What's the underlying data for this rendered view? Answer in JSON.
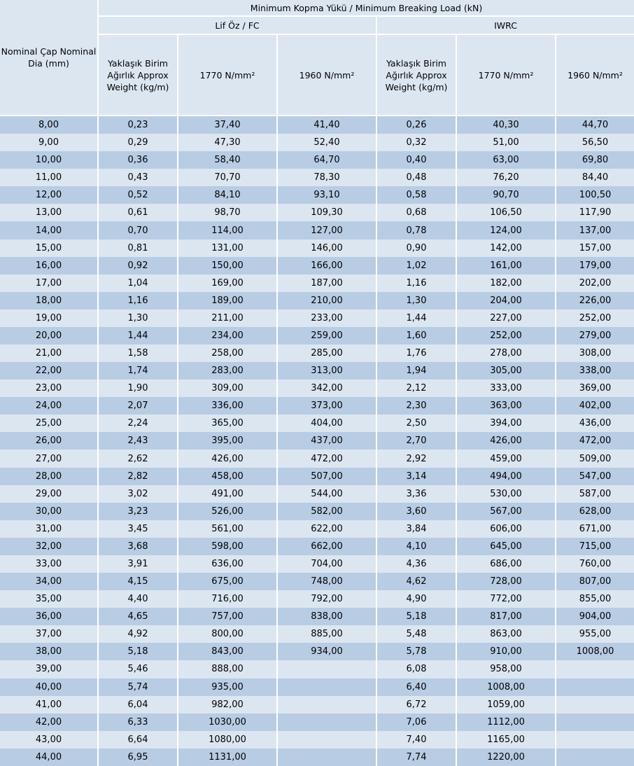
{
  "header": {
    "breaking_load": "Minimum Kopma Yükü / Minimum Breaking Load (kN)",
    "nominal_dia": "Nominal Çap Nominal Dia (mm)",
    "fc_group": "Lif Öz / FC",
    "iwrc_group": "IWRC",
    "fc_weight": "Yaklaşık Birim Ağırlık Approx Weight    (kg/m)",
    "iwrc_weight": "Yaklaşık Birim Ağırlık Approx Weight (kg/m)",
    "grade_1770_fc": "1770 N/mm²",
    "grade_1960_fc": "1960 N/mm²",
    "grade_1770_iwrc": "1770 N/mm²",
    "grade_1960_iwrc": "1960 N/mm²"
  },
  "rows": [
    [
      "8,00",
      "0,23",
      "37,40",
      "41,40",
      "0,26",
      "40,30",
      "44,70"
    ],
    [
      "9,00",
      "0,29",
      "47,30",
      "52,40",
      "0,32",
      "51,00",
      "56,50"
    ],
    [
      "10,00",
      "0,36",
      "58,40",
      "64,70",
      "0,40",
      "63,00",
      "69,80"
    ],
    [
      "11,00",
      "0,43",
      "70,70",
      "78,30",
      "0,48",
      "76,20",
      "84,40"
    ],
    [
      "12,00",
      "0,52",
      "84,10",
      "93,10",
      "0,58",
      "90,70",
      "100,50"
    ],
    [
      "13,00",
      "0,61",
      "98,70",
      "109,30",
      "0,68",
      "106,50",
      "117,90"
    ],
    [
      "14,00",
      "0,70",
      "114,00",
      "127,00",
      "0,78",
      "124,00",
      "137,00"
    ],
    [
      "15,00",
      "0,81",
      "131,00",
      "146,00",
      "0,90",
      "142,00",
      "157,00"
    ],
    [
      "16,00",
      "0,92",
      "150,00",
      "166,00",
      "1,02",
      "161,00",
      "179,00"
    ],
    [
      "17,00",
      "1,04",
      "169,00",
      "187,00",
      "1,16",
      "182,00",
      "202,00"
    ],
    [
      "18,00",
      "1,16",
      "189,00",
      "210,00",
      "1,30",
      "204,00",
      "226,00"
    ],
    [
      "19,00",
      "1,30",
      "211,00",
      "233,00",
      "1,44",
      "227,00",
      "252,00"
    ],
    [
      "20,00",
      "1,44",
      "234,00",
      "259,00",
      "1,60",
      "252,00",
      "279,00"
    ],
    [
      "21,00",
      "1,58",
      "258,00",
      "285,00",
      "1,76",
      "278,00",
      "308,00"
    ],
    [
      "22,00",
      "1,74",
      "283,00",
      "313,00",
      "1,94",
      "305,00",
      "338,00"
    ],
    [
      "23,00",
      "1,90",
      "309,00",
      "342,00",
      "2,12",
      "333,00",
      "369,00"
    ],
    [
      "24,00",
      "2,07",
      "336,00",
      "373,00",
      "2,30",
      "363,00",
      "402,00"
    ],
    [
      "25,00",
      "2,24",
      "365,00",
      "404,00",
      "2,50",
      "394,00",
      "436,00"
    ],
    [
      "26,00",
      "2,43",
      "395,00",
      "437,00",
      "2,70",
      "426,00",
      "472,00"
    ],
    [
      "27,00",
      "2,62",
      "426,00",
      "472,00",
      "2,92",
      "459,00",
      "509,00"
    ],
    [
      "28,00",
      "2,82",
      "458,00",
      "507,00",
      "3,14",
      "494,00",
      "547,00"
    ],
    [
      "29,00",
      "3,02",
      "491,00",
      "544,00",
      "3,36",
      "530,00",
      "587,00"
    ],
    [
      "30,00",
      "3,23",
      "526,00",
      "582,00",
      "3,60",
      "567,00",
      "628,00"
    ],
    [
      "31,00",
      "3,45",
      "561,00",
      "622,00",
      "3,84",
      "606,00",
      "671,00"
    ],
    [
      "32,00",
      "3,68",
      "598,00",
      "662,00",
      "4,10",
      "645,00",
      "715,00"
    ],
    [
      "33,00",
      "3,91",
      "636,00",
      "704,00",
      "4,36",
      "686,00",
      "760,00"
    ],
    [
      "34,00",
      "4,15",
      "675,00",
      "748,00",
      "4,62",
      "728,00",
      "807,00"
    ],
    [
      "35,00",
      "4,40",
      "716,00",
      "792,00",
      "4,90",
      "772,00",
      "855,00"
    ],
    [
      "36,00",
      "4,65",
      "757,00",
      "838,00",
      "5,18",
      "817,00",
      "904,00"
    ],
    [
      "37,00",
      "4,92",
      "800,00",
      "885,00",
      "5,48",
      "863,00",
      "955,00"
    ],
    [
      "38,00",
      "5,18",
      "843,00",
      "934,00",
      "5,78",
      "910,00",
      "1008,00"
    ],
    [
      "39,00",
      "5,46",
      "888,00",
      "",
      "6,08",
      "958,00",
      ""
    ],
    [
      "40,00",
      "5,74",
      "935,00",
      "",
      "6,40",
      "1008,00",
      ""
    ],
    [
      "41,00",
      "6,04",
      "982,00",
      "",
      "6,72",
      "1059,00",
      ""
    ],
    [
      "42,00",
      "6,33",
      "1030,00",
      "",
      "7,06",
      "1112,00",
      ""
    ],
    [
      "43,00",
      "6,64",
      "1080,00",
      "",
      "7,40",
      "1165,00",
      ""
    ],
    [
      "44,00",
      "6,95",
      "1131,00",
      "",
      "7,74",
      "1220,00",
      ""
    ]
  ]
}
